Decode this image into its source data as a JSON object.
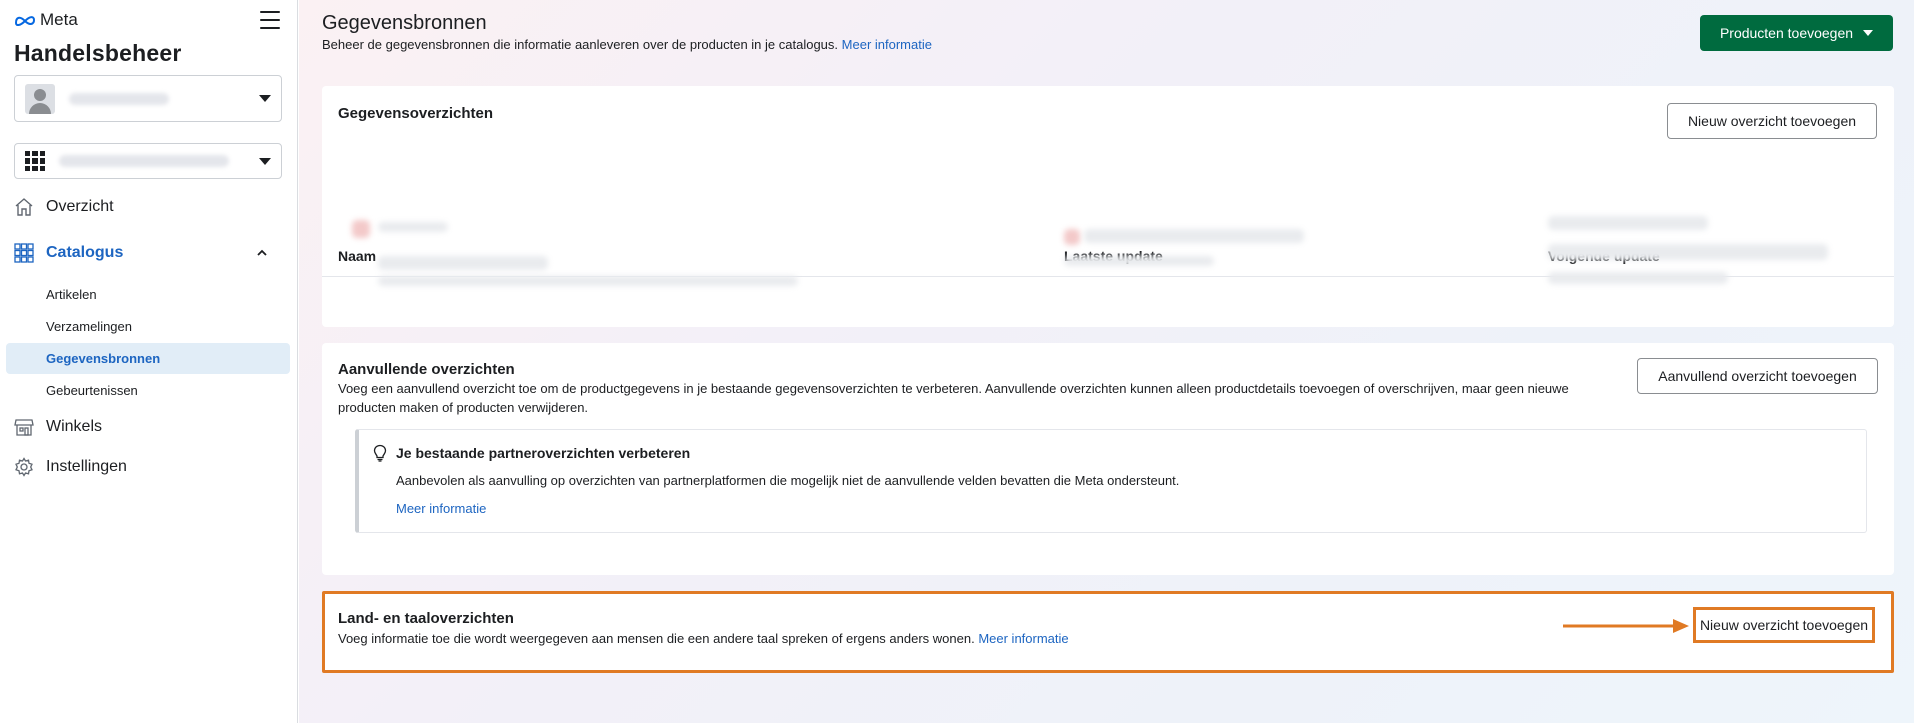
{
  "sidebar": {
    "brand": "Meta",
    "app_title": "Handelsbeheer",
    "nav": {
      "overview": "Overzicht",
      "catalog": "Catalogus",
      "catalog_sub": [
        "Artikelen",
        "Verzamelingen",
        "Gegevensbronnen",
        "Gebeurtenissen"
      ],
      "shops": "Winkels",
      "settings": "Instellingen"
    },
    "selected_sub": "Gegevensbronnen"
  },
  "header": {
    "title": "Gegevensbronnen",
    "subtitle": "Beheer de gegevensbronnen die informatie aanleveren over de producten in je catalogus.",
    "more_info": "Meer informatie",
    "add_products_button": "Producten toevoegen"
  },
  "data_feeds": {
    "title": "Gegevensoverzichten",
    "new_button": "Nieuw overzicht toevoegen",
    "columns": [
      "Naam",
      "Laatste update",
      "Volgende update"
    ]
  },
  "supplementary": {
    "title": "Aanvullende overzichten",
    "description": "Voeg een aanvullend overzicht toe om de productgegevens in je bestaande gegevensoverzichten te verbeteren. Aanvullende overzichten kunnen alleen productdetails toevoegen of overschrijven, maar geen nieuwe producten maken of producten verwijderen.",
    "button": "Aanvullend overzicht toevoegen",
    "tip": {
      "title": "Je bestaande partneroverzichten verbeteren",
      "text": "Aanbevolen als aanvulling op overzichten van partnerplatformen die mogelijk niet de aanvullende velden bevatten die Meta ondersteunt.",
      "link": "Meer informatie"
    }
  },
  "localized": {
    "title": "Land- en taaloverzichten",
    "description": "Voeg informatie toe die wordt weergegeven aan mensen die een andere taal spreken of ergens anders wonen.",
    "link": "Meer informatie",
    "button": "Nieuw overzicht toevoegen"
  },
  "colors": {
    "primary_green": "#006b3f",
    "link_blue": "#1d65c1",
    "highlight_orange": "#e07a24",
    "selected_bg": "#e1edf7"
  }
}
